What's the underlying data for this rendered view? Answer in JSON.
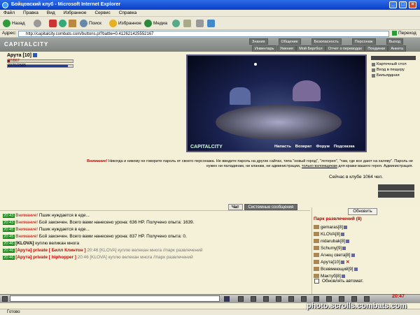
{
  "window": {
    "title": "Бойцовский клуб - Microsoft Internet Explorer"
  },
  "menu": [
    "Файл",
    "Правка",
    "Вид",
    "Избранное",
    "Сервис",
    "Справка"
  ],
  "toolbar": {
    "back": "Назад",
    "search": "Поиск",
    "favorites": "Избранное",
    "media": "Медиа"
  },
  "address": {
    "label": "Адрес:",
    "url": "http://capitalcity.combats.com/buttons.pl?battle=0.412621425552167",
    "go": "Переход"
  },
  "game": {
    "logo": "CAPITALCITY",
    "nav_top": [
      "Знания",
      "Общение",
      "Безопасность",
      "Персонаж",
      "Выход"
    ],
    "nav_bottom": [
      "Инвентарь",
      "Умения",
      "Мой Бергбол",
      "Отчет о переводах",
      "Поединки",
      "Анкета"
    ],
    "player": {
      "name": "Арута [10]",
      "hp_text": "27/867",
      "mp_text": "2370/2585",
      "hp_fraction": 0.03,
      "mp_fraction": 0.92
    },
    "scene": {
      "logo": "CAPITALCITY",
      "links": [
        "Напасть",
        "Возврат",
        "Форум",
        "Подсказка"
      ]
    },
    "side_menu": [
      "Карточный стол",
      "Вход в пещеру",
      "Бильярдная"
    ],
    "warning_bold": "Внимание!",
    "warning_text": "Никогда и никому не говорите пароль от своего персонажа. Не вводите пароль на других сайтах, типа \"новый город\", \"лотерея\", \"там, где все дают на халяву\". Пароль не нужен ни паладинам, ни кланам, ни администрации,",
    "warning_link": "только взломщикам",
    "warning_tail": "для кражи вашего героя. Администрация.",
    "online": "Сейчас в клубе 1064 чел.",
    "tabs": {
      "chat": "Чат",
      "system": "Системные сообщения"
    },
    "chat": [
      {
        "time": "20:43",
        "kind": "sys",
        "prefix": "Внимание!",
        "text": "Пшик нуждается в еде..."
      },
      {
        "time": "20:43",
        "kind": "sys",
        "prefix": "Внимание!",
        "text": "Бой закончен. Всего вами нанесено урона: 636 HP. Получено опыта: 1639."
      },
      {
        "time": "20:45",
        "kind": "sys",
        "prefix": "Внимание!",
        "text": "Пшик нуждается в еде..."
      },
      {
        "time": "20:45",
        "kind": "sys",
        "prefix": "Внимание!",
        "text": "Бой закончен. Всего вами нанесено урона: 837 HP. Получено опыта: 0."
      },
      {
        "time": "20:46",
        "kind": "msg",
        "prefix": "[KLOVA]",
        "text": "куплю великан многа"
      },
      {
        "time": "20:46",
        "kind": "priv",
        "prefix": "[Арута] private [ Билл Клинтон ]",
        "text": "20:46 [KLOVA] куплю велекан многа //парк развлечений"
      },
      {
        "time": "20:46",
        "kind": "priv",
        "prefix": "[Арута] private [ hiphopper ]",
        "text": "20:46 [KLOVA] куплю велекан многа //парк развлечений"
      }
    ],
    "refresh": "Обновить",
    "room": "Парк развлечений (8)",
    "users": [
      "gemaras[8]",
      "KLOVA[8]",
      "nidarubak[8]",
      "Schumy[9]",
      "Агнец света[8]",
      "Арута[10]",
      "Всевмеющий[9]",
      "Мактуб[8]"
    ],
    "auto_update": "Обновлять автомат.",
    "clock": "20:47"
  },
  "status": {
    "text": "Готово"
  },
  "watermark": "photo.scrolls.combats.com",
  "colors": {
    "title_blue": "#0a3fc4",
    "hp_red": "#c00000",
    "mp_blue": "#1a3aa8",
    "chat_time_green": "#1a8a1a"
  }
}
